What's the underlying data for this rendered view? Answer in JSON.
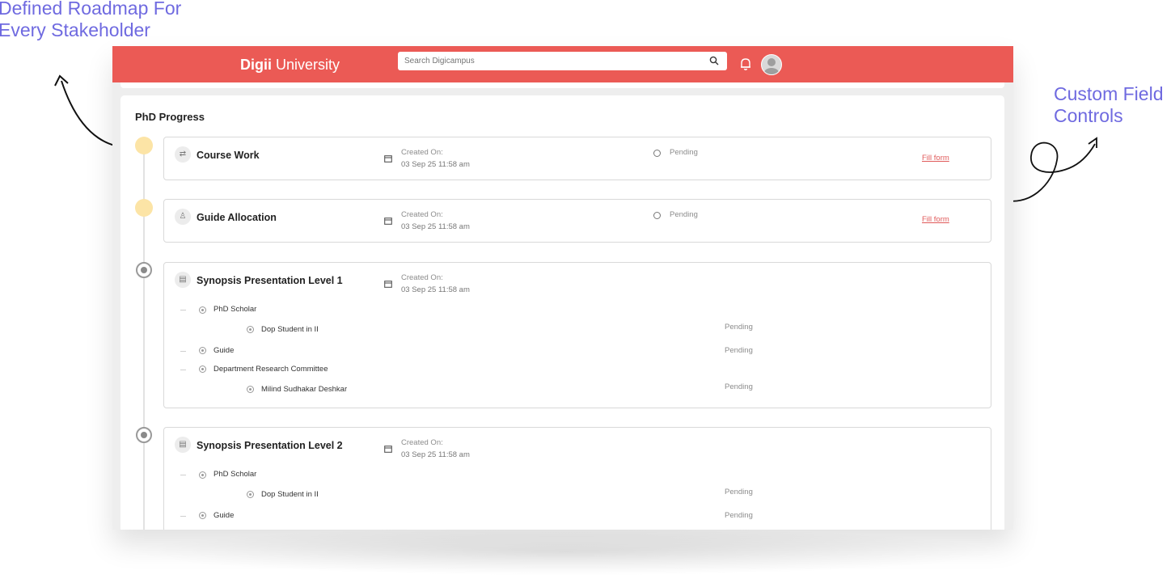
{
  "annotations": {
    "left_line1": "Defined Roadmap For",
    "left_line2": "Every Stakeholder",
    "right_line1": "Custom Field",
    "right_line2": "Controls"
  },
  "header": {
    "logo_mark": "D",
    "logo_bold": "igii",
    "logo_rest": " University",
    "search_placeholder": "Search Digicampus"
  },
  "colors": {
    "brand": "#eb5a55",
    "annotation": "#6f6ae0",
    "link": "#e05a5a",
    "timeline_active": "#fce4a6"
  },
  "page": {
    "title": "PhD Progress"
  },
  "stages": [
    {
      "title": "Course Work",
      "icon": "coursework-icon",
      "created_label": "Created On:",
      "created_date": "03 Sep 25 11:58 am",
      "status": "Pending",
      "action": "Fill form"
    },
    {
      "title": "Guide Allocation",
      "icon": "guide-allocation-icon",
      "created_label": "Created On:",
      "created_date": "03 Sep 25 11:58 am",
      "status": "Pending",
      "action": "Fill form"
    },
    {
      "title": "Synopsis Presentation Level 1",
      "icon": "document-icon",
      "created_label": "Created On:",
      "created_date": "03 Sep 25 11:58 am",
      "roles": [
        {
          "name": "PhD Scholar",
          "members": [
            {
              "name": "Dop Student in II",
              "status": "Pending"
            }
          ]
        },
        {
          "name": "Guide",
          "status": "Pending",
          "members": []
        },
        {
          "name": "Department Research Committee",
          "members": [
            {
              "name": "Milind Sudhakar Deshkar",
              "status": "Pending"
            }
          ]
        }
      ]
    },
    {
      "title": "Synopsis Presentation Level 2",
      "icon": "document-icon",
      "created_label": "Created On:",
      "created_date": "03 Sep 25 11:58 am",
      "roles": [
        {
          "name": "PhD Scholar",
          "members": [
            {
              "name": "Dop Student in II",
              "status": "Pending"
            }
          ]
        },
        {
          "name": "Guide",
          "status": "Pending",
          "members": []
        }
      ]
    }
  ]
}
